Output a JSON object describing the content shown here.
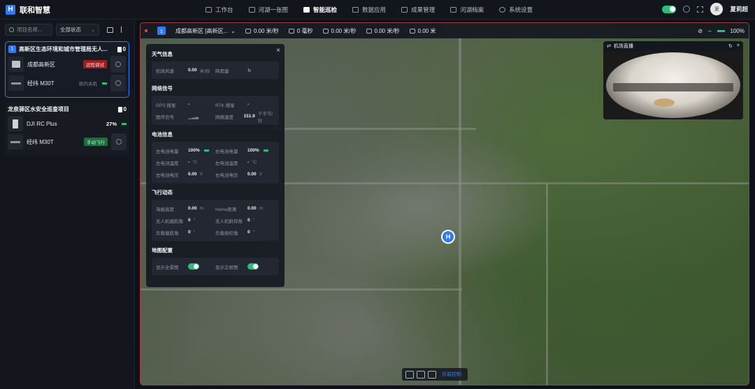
{
  "app": {
    "title": "联和智慧"
  },
  "nav": [
    {
      "label": "工作台",
      "icon": "monitor-icon"
    },
    {
      "label": "河湖一张图",
      "icon": "map-icon"
    },
    {
      "label": "智能巡检",
      "icon": "check-icon"
    },
    {
      "label": "数据应用",
      "icon": "chart-icon"
    },
    {
      "label": "成果管理",
      "icon": "folder-icon"
    },
    {
      "label": "河湖档案",
      "icon": "archive-icon"
    },
    {
      "label": "系统设置",
      "icon": "gear-icon"
    }
  ],
  "user": {
    "name": "夏莉超",
    "avatar_text": "夏"
  },
  "sidebar": {
    "search_placeholder": "项目名称...",
    "filter_value": "全部状态",
    "projects": [
      {
        "num": "1",
        "title": "高新区生态环境和城市管理局无人...",
        "count": "0",
        "devices": [
          {
            "name": "成都高新区",
            "badge": "远程调试",
            "type": "dock"
          },
          {
            "name": "经纬 M30T",
            "badge": "舱内关机",
            "type": "drone"
          }
        ]
      },
      {
        "title": "龙泉驿区水安全巡查项目",
        "count": "0",
        "devices": [
          {
            "name": "DJI RC Plus",
            "battery": "27%",
            "type": "rc"
          },
          {
            "name": "经纬 M30T",
            "badge": "手动飞行",
            "type": "drone"
          }
        ]
      }
    ]
  },
  "mapbar": {
    "num": "1",
    "location": "成都高新区 [高新区...",
    "hspeed": "0.00 米/秒",
    "height": "0 毫秒",
    "vspeed": "0.00 米/秒",
    "wind": "0.00 米/秒",
    "distance": "0.00 米",
    "battery": "100%"
  },
  "panel": {
    "weather_title": "天气信息",
    "weather": [
      {
        "k": "机场风速",
        "v": "0.00",
        "u": "米/秒"
      },
      {
        "k": "降雨量",
        "v": "",
        "u": ""
      }
    ],
    "network_title": "网络信号",
    "network": [
      [
        {
          "k": "GPS 搜星",
          "v": "-",
          "u": ""
        },
        {
          "k": "RTK 搜星",
          "v": "-",
          "u": ""
        }
      ],
      [
        {
          "k": "图传信号",
          "v": "",
          "u": ""
        },
        {
          "k": "网络速度",
          "v": "151.9",
          "u": "千字节/秒"
        }
      ]
    ],
    "battery_title": "电池信息",
    "battery": [
      [
        {
          "k": "左电池电量",
          "v": "100%",
          "u": ""
        },
        {
          "k": "右电池电量",
          "v": "100%",
          "u": ""
        }
      ],
      [
        {
          "k": "左电池温度",
          "v": "-",
          "u": "°C"
        },
        {
          "k": "右电池温度",
          "v": "-",
          "u": "°C"
        }
      ],
      [
        {
          "k": "左电池电压",
          "v": "0.00",
          "u": "V"
        },
        {
          "k": "右电池电压",
          "v": "0.00",
          "u": "V"
        }
      ]
    ],
    "flight_title": "飞行动态",
    "flight": [
      [
        {
          "k": "海拔高度",
          "v": "0.00",
          "u": "m"
        },
        {
          "k": "Home距离",
          "v": "0.00",
          "u": "m"
        }
      ],
      [
        {
          "k": "无人机偏航角",
          "v": "0",
          "u": "°"
        },
        {
          "k": "无人机俯仰角",
          "v": "0",
          "u": "°"
        }
      ],
      [
        {
          "k": "负载偏航角",
          "v": "0",
          "u": "°"
        },
        {
          "k": "负载俯仰角",
          "v": "0",
          "u": "°"
        }
      ]
    ],
    "mapcfg_title": "地图配置",
    "mapcfg": [
      {
        "k": "显示全景图"
      },
      {
        "k": "显示正射图"
      }
    ]
  },
  "camera": {
    "title": "机场直播"
  },
  "marker": {
    "label": "H"
  },
  "bottom": {
    "label": "负载控制"
  },
  "colors": {
    "accent": "#2d7bf6",
    "ok": "#27c27a",
    "alert": "#9a2020"
  }
}
